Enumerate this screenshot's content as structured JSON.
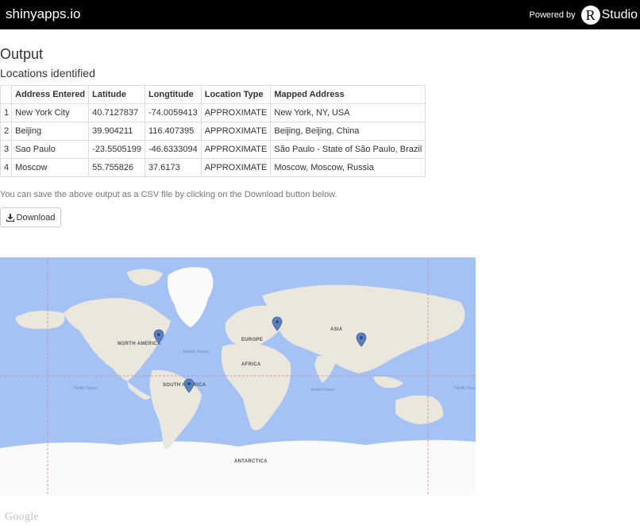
{
  "header": {
    "brand": "shinyapps.io",
    "powered_by": "Powered by",
    "logo_letter": "R",
    "logo_word": "Studio"
  },
  "output": {
    "title": "Output",
    "subtitle": "Locations identified"
  },
  "table": {
    "columns": [
      "Address Entered",
      "Latitude",
      "Longtitude",
      "Location Type",
      "Mapped Address"
    ],
    "rows": [
      {
        "index": "1",
        "address": "New York City",
        "lat": "40.7127837",
        "lng": "-74.0059413",
        "type": "APPROXIMATE",
        "mapped": "New York, NY, USA"
      },
      {
        "index": "2",
        "address": "Beijing",
        "lat": "39.904211",
        "lng": "116.407395",
        "type": "APPROXIMATE",
        "mapped": "Beijing, Beijing, China"
      },
      {
        "index": "3",
        "address": "Sao Paulo",
        "lat": "-23.5505199",
        "lng": "-46.6333094",
        "type": "APPROXIMATE",
        "mapped": "São Paulo - State of São Paulo, Brazil"
      },
      {
        "index": "4",
        "address": "Moscow",
        "lat": "55.755826",
        "lng": "37.6173",
        "type": "APPROXIMATE",
        "mapped": "Moscow, Moscow, Russia"
      }
    ]
  },
  "download": {
    "note": "You can save the above output as a CSV file by clicking on the Download button below.",
    "button_label": "Download",
    "icon": "download-icon"
  },
  "map": {
    "labels": {
      "north_america": "NORTH AMERICA",
      "south_america": "SOUTH AMERICA",
      "europe": "EUROPE",
      "asia": "ASIA",
      "africa": "AFRICA",
      "antarctica": "ANTARCTICA",
      "atlantic": "Atlantic Ocean",
      "pacific": "Pacific Ocean",
      "indian": "Indian Ocean"
    },
    "markers": [
      "New York City",
      "Beijing",
      "Sao Paulo",
      "Moscow"
    ],
    "colors": {
      "ocean": "#a4c2f4",
      "land": "#ebe7dc",
      "ice": "#fafafa",
      "marker": "#5a7fbf"
    },
    "attribution": "Google"
  }
}
